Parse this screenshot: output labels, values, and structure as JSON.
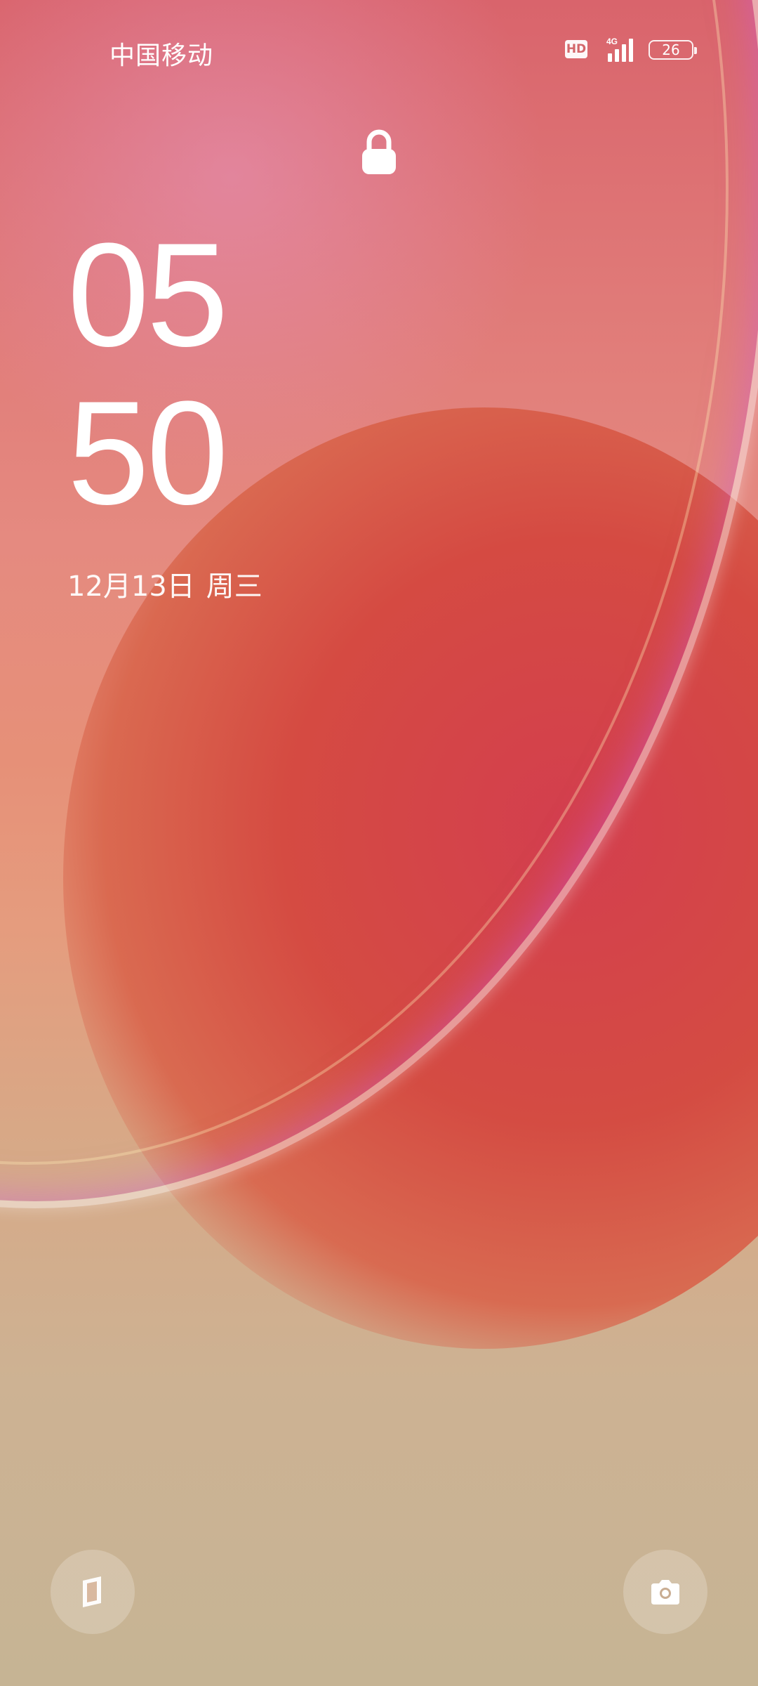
{
  "status_bar": {
    "carrier": "中国移动",
    "hd_badge": "HD",
    "network_type": "4G",
    "battery_level": "26"
  },
  "lockscreen": {
    "clock": {
      "hour": "05",
      "minute": "50"
    },
    "date": {
      "date_text": "12月13日",
      "weekday": "周三"
    },
    "icons": {
      "lock": "lock-icon",
      "left_shortcut": "wallet-icon",
      "right_shortcut": "camera-icon"
    }
  }
}
